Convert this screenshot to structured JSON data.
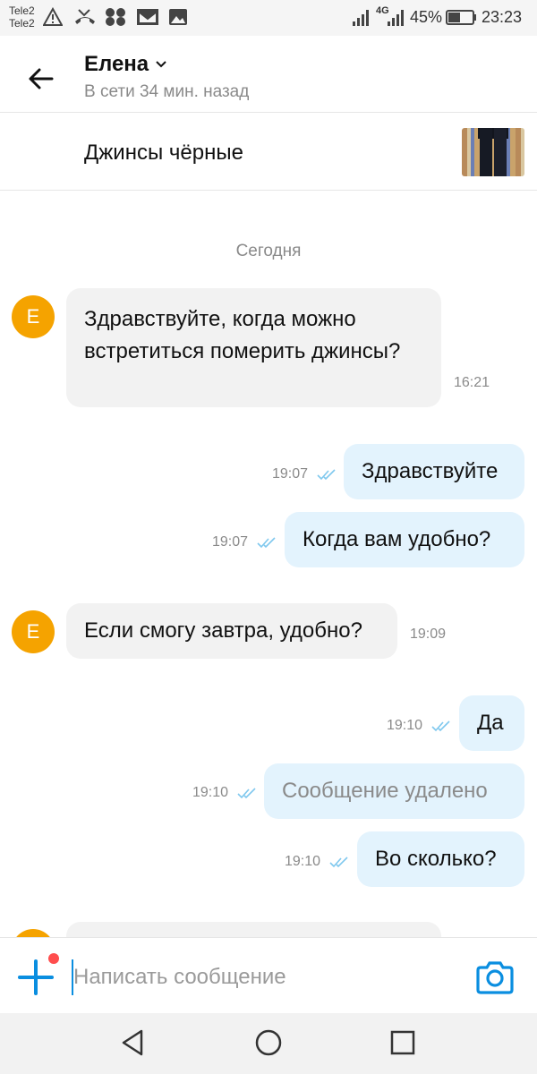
{
  "status_bar": {
    "carrier1": "Tele2",
    "carrier2": "Tele2",
    "network": "4G",
    "battery": "45%",
    "time": "23:23"
  },
  "header": {
    "contact_name": "Елена",
    "status": "В сети 34 мин. назад"
  },
  "item": {
    "title": "Джинсы чёрные"
  },
  "chat": {
    "date_label": "Сегодня",
    "avatar_letter": "E",
    "messages": [
      {
        "direction": "in",
        "text": "Здравствуйте, когда можно встретиться померить джинсы?",
        "time": "16:21"
      },
      {
        "direction": "out",
        "text": "Здравствуйте",
        "time": "19:07",
        "read": true
      },
      {
        "direction": "out",
        "text": "Когда вам удобно?",
        "time": "19:07",
        "read": true
      },
      {
        "direction": "in",
        "text": "Если смогу завтра, удобно?",
        "time": "19:09"
      },
      {
        "direction": "out",
        "text": "Да",
        "time": "19:10",
        "read": true
      },
      {
        "direction": "out",
        "text": "Сообщение удалено",
        "time": "19:10",
        "read": true,
        "deleted": true
      },
      {
        "direction": "out",
        "text": "Во сколько?",
        "time": "19:10",
        "read": true
      }
    ]
  },
  "composer": {
    "placeholder": "Написать сообщение",
    "value": ""
  },
  "colors": {
    "accent": "#0a8ee0",
    "avatar": "#f5a300",
    "outgoing_bubble": "#e3f3fd",
    "incoming_bubble": "#f2f2f2",
    "notification_dot": "#ff4d4d"
  }
}
